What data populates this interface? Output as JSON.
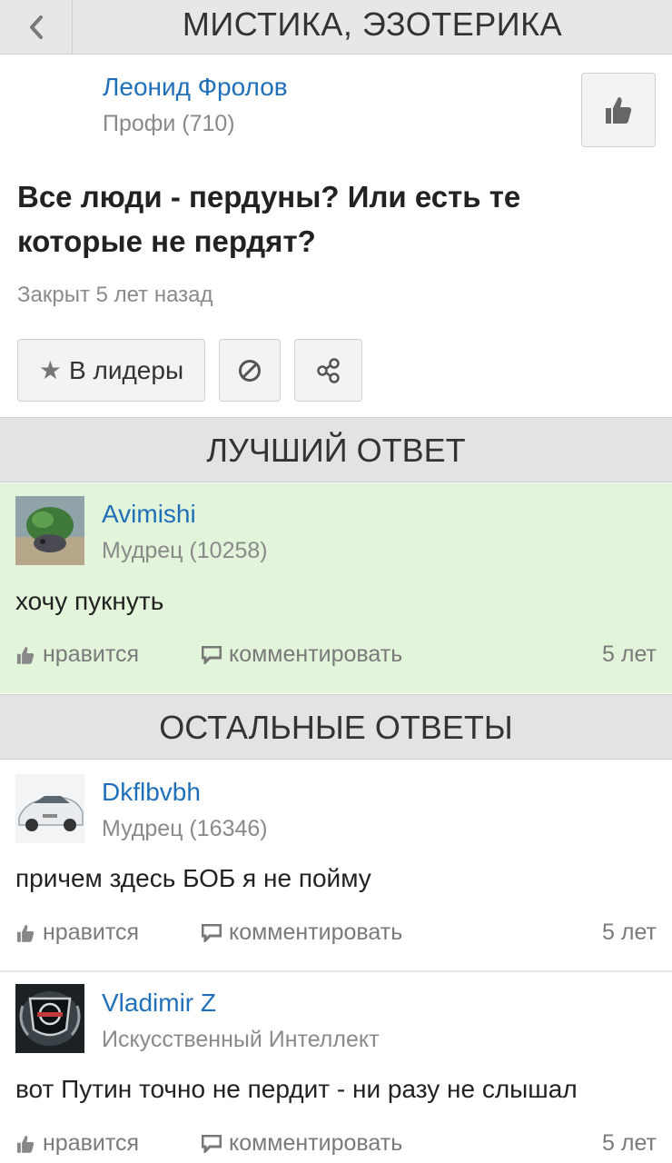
{
  "header": {
    "title": "МИСТИКА, ЭЗОТЕРИКА",
    "back_icon": "chevron-left-icon"
  },
  "question": {
    "author": "Леонид Фролов",
    "author_rank": "Профи (710)",
    "text": "Все люди - пердуны? Или есть те которые не пердят?",
    "status": "Закрыт 5 лет назад",
    "leaders_button": "В лидеры",
    "like_icon": "thumbs-up-icon",
    "block_icon": "block-icon",
    "share_icon": "share-icon"
  },
  "sections": {
    "best": "ЛУЧШИЙ ОТВЕТ",
    "others": "ОСТАЛЬНЫЕ ОТВЕТЫ"
  },
  "best_answer": {
    "author": "Avimishi",
    "rank": "Мудрец (10258)",
    "text": "хочу пукнуть",
    "like_label": "нравится",
    "comment_label": "комментировать",
    "time": "5 лет"
  },
  "answers": [
    {
      "author": "Dkflbvbh",
      "rank": "Мудрец (16346)",
      "text": "причем здесь БОБ я не пойму",
      "like_label": "нравится",
      "comment_label": "комментировать",
      "time": "5 лет"
    },
    {
      "author": "Vladimir Z",
      "rank": "Искусственный Интеллект",
      "text": "вот Путин точно не пердит - ни разу не слышал",
      "like_label": "нравится",
      "comment_label": "комментировать",
      "time": "5 лет"
    }
  ],
  "colors": {
    "link": "#1f6fb9",
    "best_bg": "#e2f4d9",
    "section_bg": "#e3e3e3"
  }
}
